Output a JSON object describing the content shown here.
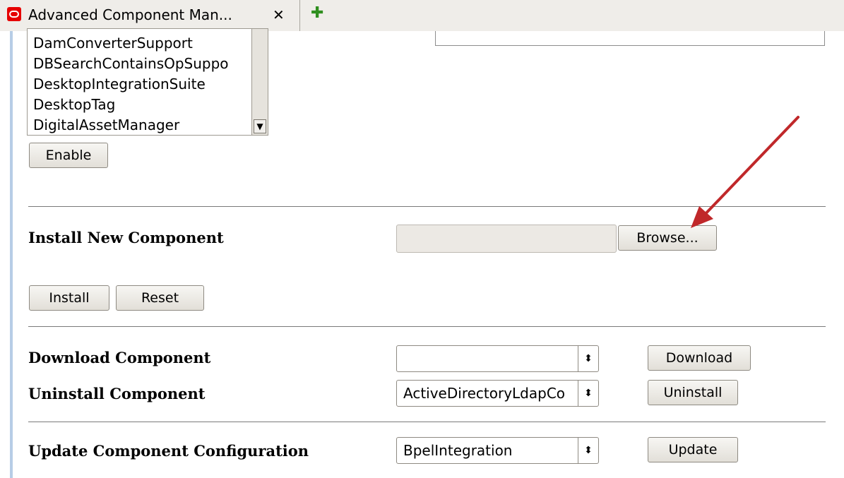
{
  "tab": {
    "title": "Advanced Component Man...",
    "close_icon": "close-icon",
    "new_tab_icon": "plus-icon"
  },
  "listbox": {
    "items": [
      "DamConverterSupport",
      "DBSearchContainsOpSuppo",
      "DesktopIntegrationSuite",
      "DesktopTag",
      "DigitalAssetManager"
    ]
  },
  "buttons": {
    "enable": "Enable",
    "browse": "Browse...",
    "install": "Install",
    "reset": "Reset",
    "download": "Download",
    "uninstall": "Uninstall",
    "update": "Update"
  },
  "labels": {
    "install_new": "Install New Component",
    "download": "Download Component",
    "uninstall": "Uninstall Component",
    "update": "Update Component Configuration"
  },
  "selects": {
    "download_value": "",
    "uninstall_value": "ActiveDirectoryLdapCo",
    "update_value": "BpelIntegration"
  },
  "colors": {
    "annotation_arrow": "#c0282a",
    "tab_logo": "#e60000"
  }
}
